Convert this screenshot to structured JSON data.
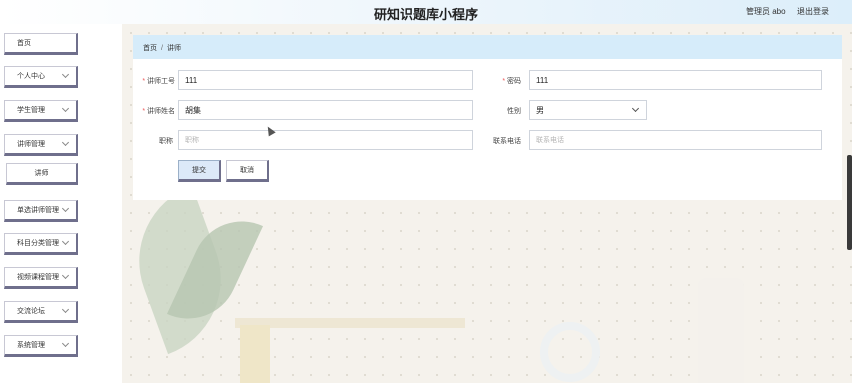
{
  "header": {
    "title": "研知识题库小程序",
    "admin": "管理员 abo",
    "logout": "退出登录"
  },
  "sidebar": {
    "items": [
      {
        "label": "首页"
      },
      {
        "label": "个人中心"
      },
      {
        "label": "学生管理"
      },
      {
        "label": "讲师管理"
      },
      {
        "label": "讲师"
      },
      {
        "label": "单选讲师管理"
      },
      {
        "label": "科目分类管理"
      },
      {
        "label": "视频课程管理"
      },
      {
        "label": "交流论坛"
      },
      {
        "label": "系统管理"
      }
    ]
  },
  "breadcrumb": {
    "home": "首页",
    "separator": "/",
    "current": "讲师"
  },
  "form": {
    "teacher_id_label": "讲师工号",
    "teacher_id_value": "111",
    "password_label": "密码",
    "password_value": "111",
    "teacher_name_label": "讲师姓名",
    "teacher_name_value": "胡集",
    "gender_label": "性别",
    "gender_value": "男",
    "title_label": "职称",
    "title_placeholder": "职称",
    "phone_label": "联系电话",
    "phone_placeholder": "联系电话",
    "submit_label": "提交",
    "cancel_label": "取消"
  },
  "icons": {
    "chevron": "chevron-down-icon",
    "cursor": "mouse-cursor-icon"
  }
}
